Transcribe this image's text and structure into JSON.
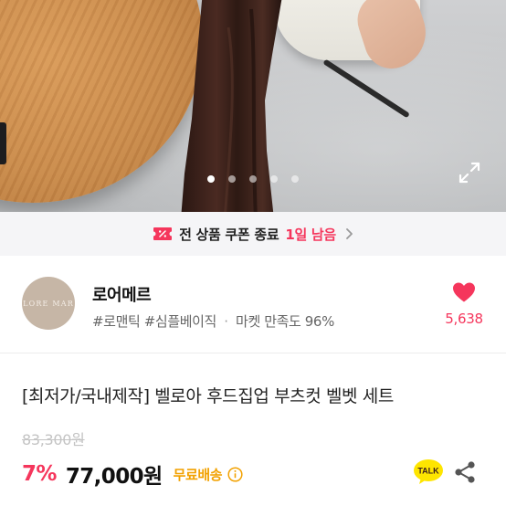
{
  "carousel": {
    "total_dots": 5,
    "active_index": 0
  },
  "coupon_banner": {
    "text": "전 상품 쿠폰 종료",
    "remaining": "1일 남음",
    "icon": "coupon-icon"
  },
  "shop": {
    "avatar_text": "LORE MAR",
    "name": "로어메르",
    "tag_1": "#로맨틱",
    "tag_2": "#심플베이직",
    "separator": "·",
    "satisfaction": "마켓 만족도 96%",
    "like_count": "5,638",
    "like_icon": "heart-icon"
  },
  "product": {
    "title": "[최저가/국내제작] 벨로아 후드집업 부츠컷 벨벳 세트",
    "original_price": "83,300원",
    "discount": "7%",
    "price": "77,000원",
    "shipping": "무료배송"
  },
  "actions": {
    "talk_label": "TALK"
  },
  "colors": {
    "accent": "#f5365c",
    "shipping": "#f2a100",
    "talk": "#fee500"
  }
}
